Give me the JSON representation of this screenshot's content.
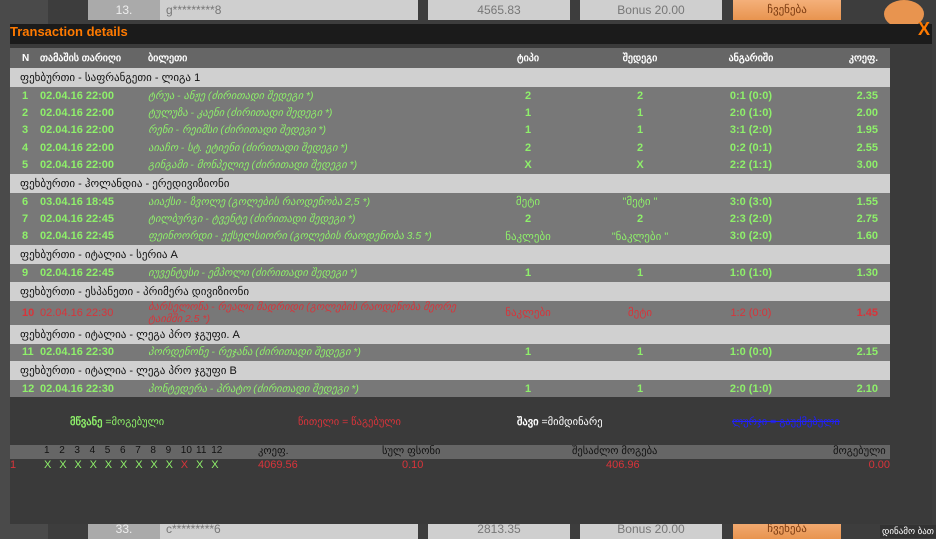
{
  "background": {
    "top_row": {
      "rank": "13.",
      "user": "g*********8",
      "amount": "4565.83",
      "bonus": "Bonus 20.00",
      "button": "ჩვენება"
    },
    "bottom_row": {
      "rank": "33.",
      "user": "c*********6",
      "amount": "2813.35",
      "bonus": "Bonus 20.00",
      "button": "ჩვენება"
    },
    "corner_label": "დინამო ბათ"
  },
  "modal": {
    "title": "Transaction details",
    "close": "X",
    "columns": [
      "N",
      "თამაშის თარიღი",
      "ბილეთი",
      "ტიპი",
      "შედეგი",
      "ანგარიში",
      "კოეფ."
    ],
    "groups": [
      {
        "name": "ფეხბურთი - საფრანგეთი - ლიგა 1",
        "rows": [
          {
            "n": "1",
            "date": "02.04.16 22:00",
            "ticket": "ტრუა - ანჟე (ძირითადი შედეგი *)",
            "type": "2",
            "result": "2",
            "score": "0:1 (0:0)",
            "coef": "2.35",
            "status": "won"
          },
          {
            "n": "2",
            "date": "02.04.16 22:00",
            "ticket": "ტულუზა - კაენი (ძირითადი შედეგი *)",
            "type": "1",
            "result": "1",
            "score": "2:0 (1:0)",
            "coef": "2.00",
            "status": "won"
          },
          {
            "n": "3",
            "date": "02.04.16 22:00",
            "ticket": "რენი - რეიმსი (ძირითადი შედეგი *)",
            "type": "1",
            "result": "1",
            "score": "3:1 (2:0)",
            "coef": "1.95",
            "status": "won"
          },
          {
            "n": "4",
            "date": "02.04.16 22:00",
            "ticket": "აიაჩო - სტ. ეტიენი (ძირითადი შედეგი *)",
            "type": "2",
            "result": "2",
            "score": "0:2 (0:1)",
            "coef": "2.55",
            "status": "won"
          },
          {
            "n": "5",
            "date": "02.04.16 22:00",
            "ticket": "გინგამი - მონპელიე (ძირითადი შედეგი *)",
            "type": "X",
            "result": "X",
            "score": "2:2 (1:1)",
            "coef": "3.00",
            "status": "won"
          }
        ]
      },
      {
        "name": "ფეხბურთი - ჰოლანდია - ერედივიზიონი",
        "rows": [
          {
            "n": "6",
            "date": "03.04.16 18:45",
            "ticket": "აიაქსი - ზვოლე (გოლების რაოდენობა 2,5 *)",
            "type": "მეტი",
            "result": "\"მეტი \"",
            "score": "3:0 (3:0)",
            "coef": "1.55",
            "status": "won"
          },
          {
            "n": "7",
            "date": "02.04.16 22:45",
            "ticket": "ტილბურგი - ტვენტე (ძირითადი შედეგი *)",
            "type": "2",
            "result": "2",
            "score": "2:3 (2:0)",
            "coef": "2.75",
            "status": "won"
          },
          {
            "n": "8",
            "date": "02.04.16 22:45",
            "ticket": "ფეინოორდი - ექსელსიორი (გოლების რაოდენობა 3.5 *)",
            "type": "ნაკლები",
            "result": "\"ნაკლები \"",
            "score": "3:0 (2:0)",
            "coef": "1.60",
            "status": "won"
          }
        ]
      },
      {
        "name": "ფეხბურთი - იტალია - სერია A",
        "rows": [
          {
            "n": "9",
            "date": "02.04.16 22:45",
            "ticket": "იუვენტუსი - ემპოლი (ძირითადი შედეგი *)",
            "type": "1",
            "result": "1",
            "score": "1:0 (1:0)",
            "coef": "1.30",
            "status": "won"
          }
        ]
      },
      {
        "name": "ფეხბურთი - ესპანეთი - პრიმერა დივიზიონი",
        "rows": [
          {
            "n": "10",
            "date": "02.04.16 22:30",
            "ticket": "ბარსელონა - რეალი მადრიდი (გოლების რაოდენობა მეორე ტაიმში 2.5 *)",
            "type": "ნაკლები",
            "result": "მეტი",
            "score": "1:2 (0:0)",
            "coef": "1.45",
            "status": "lost"
          }
        ]
      },
      {
        "name": "ფეხბურთი - იტალია - ლეგა პრო ჯგუფი. A",
        "rows": [
          {
            "n": "11",
            "date": "02.04.16 22:30",
            "ticket": "პორდენონე - რეჯანა (ძირითადი შედეგი *)",
            "type": "1",
            "result": "1",
            "score": "1:0 (0:0)",
            "coef": "2.15",
            "status": "won"
          }
        ]
      },
      {
        "name": "ფეხბურთი - იტალია - ლეგა პრო ჯგუფი B",
        "rows": [
          {
            "n": "12",
            "date": "02.04.16 22:30",
            "ticket": "პონტედერა - პრატო (ძირითადი შედეგი *)",
            "type": "1",
            "result": "1",
            "score": "2:0 (1:0)",
            "coef": "2.10",
            "status": "won"
          }
        ]
      }
    ],
    "legend": {
      "green_word": "მწვანე",
      "green_rest": " =მოგებული",
      "red": "წითელი = წაგებული",
      "black_word": "შავი",
      "black_rest": " =მიმდინარე",
      "blue": "ლურჯი = გაუქმებული"
    },
    "summary": {
      "headers": {
        "coef": "კოეფ.",
        "stake": "სულ ფსონი",
        "possible": "შესაძლო მოგება",
        "won": "მოგებული"
      },
      "event_numbers": [
        "1",
        "2",
        "3",
        "4",
        "5",
        "6",
        "7",
        "8",
        "9",
        "10",
        "11",
        "12"
      ],
      "row": {
        "n": "1",
        "marks": [
          "X",
          "X",
          "X",
          "X",
          "X",
          "X",
          "X",
          "X",
          "X",
          "X",
          "X",
          "X"
        ],
        "mark_status": [
          "won",
          "won",
          "won",
          "won",
          "won",
          "won",
          "won",
          "won",
          "won",
          "lost",
          "won",
          "won"
        ],
        "coef": "4069.56",
        "stake": "0.10",
        "possible": "406.96",
        "won": "0.00"
      }
    }
  },
  "colors": {
    "won": "#8ef06a",
    "lost": "#d8343a",
    "accent": "#ff7a00",
    "cancelled": "#2020ff"
  }
}
